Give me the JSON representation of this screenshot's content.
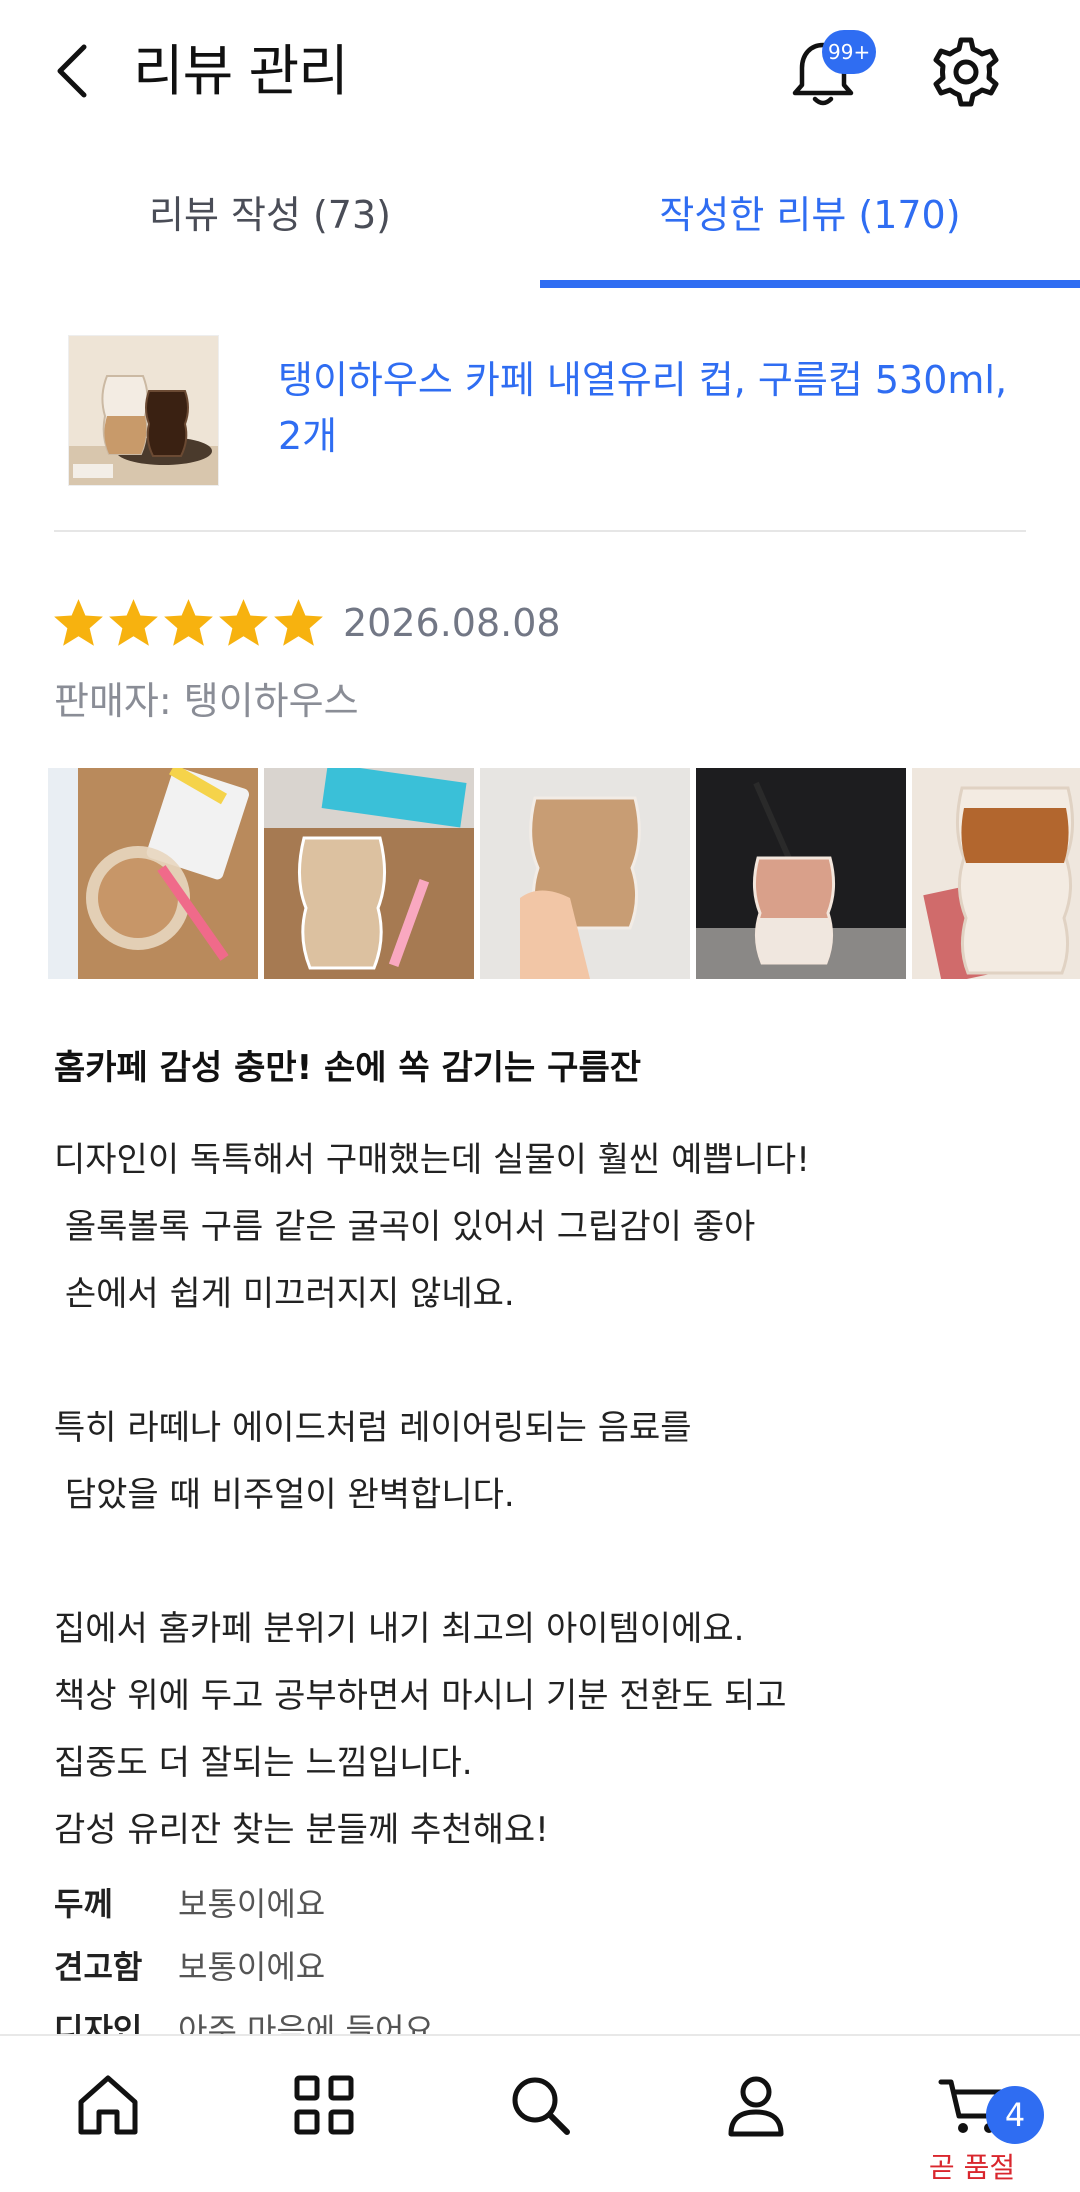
{
  "header": {
    "title": "리뷰 관리",
    "notification_badge": "99+"
  },
  "tabs": [
    {
      "label": "리뷰 작성 (73)",
      "active": false
    },
    {
      "label": "작성한 리뷰 (170)",
      "active": true
    }
  ],
  "product": {
    "name": "탱이하우스 카페 내열유리 컵, 구름컵 530ml, 2개"
  },
  "review": {
    "rating": 5,
    "date": "2026.08.08",
    "seller": "판매자: 탱이하우스",
    "title": "홈카페 감성 충만! 손에 쏙 감기는 구름잔",
    "body": "디자인이 독특해서 구매했는데 실물이 훨씬 예쁩니다!\n 올록볼록 구름 같은 굴곡이 있어서 그립감이 좋아\n 손에서 쉽게 미끄러지지 않네요.\n\n특히 라떼나 에이드처럼 레이어링되는 음료를\n 담았을 때 비주얼이 완벽합니다.\n\n집에서 홈카페 분위기 내기 최고의 아이템이에요.\n책상 위에 두고 공부하면서 마시니 기분 전환도 되고\n집중도 더 잘되는 느낌입니다.\n감성 유리잔 찾는 분들께 추천해요!",
    "attributes": [
      {
        "key": "두께",
        "value": "보통이에요"
      },
      {
        "key": "견고함",
        "value": "보통이에요"
      },
      {
        "key": "디자인",
        "value": "아주 마음에 들어요"
      }
    ],
    "photo_count_visible": 5
  },
  "bottom_nav": {
    "items": [
      "home-icon",
      "category-grid-icon",
      "search-icon",
      "profile-icon",
      "cart-icon"
    ],
    "cart_badge": "4",
    "cart_label": "곧 품절"
  },
  "colors": {
    "accent": "#2f6df2",
    "star": "#f7b20f",
    "soldout": "#d9262d"
  }
}
